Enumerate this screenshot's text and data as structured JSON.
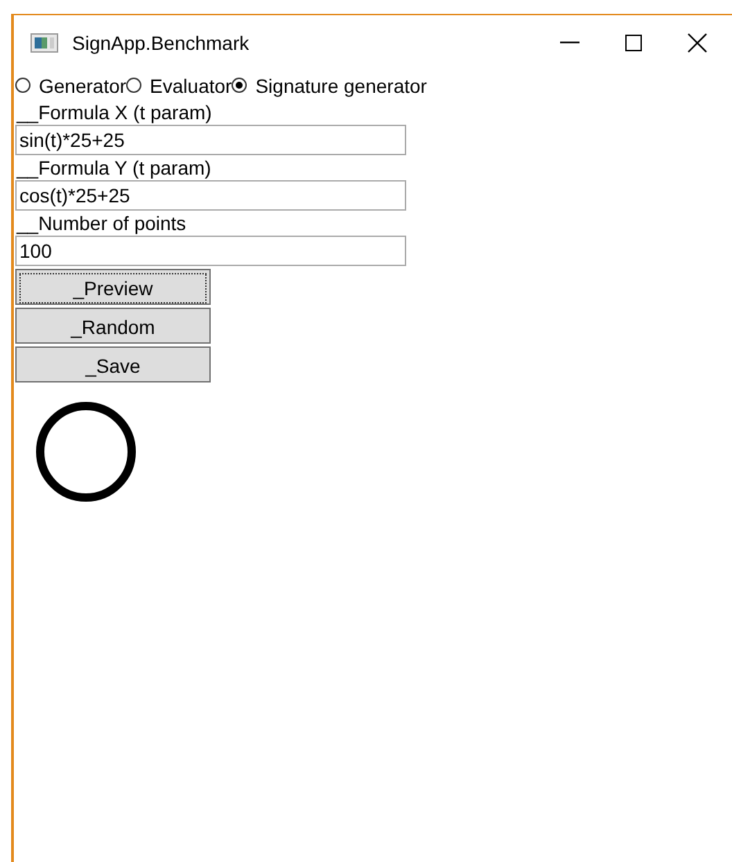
{
  "window": {
    "title": "SignApp.Benchmark"
  },
  "modes": [
    {
      "label": "Generator",
      "selected": false
    },
    {
      "label": "Evaluator",
      "selected": false
    },
    {
      "label": "Signature generator",
      "selected": true
    }
  ],
  "fields": [
    {
      "label": "__Formula X (t param)",
      "value": "sin(t)*25+25"
    },
    {
      "label": "__Formula Y (t param)",
      "value": "cos(t)*25+25"
    },
    {
      "label": "__Number of points",
      "value": "100"
    }
  ],
  "buttons": [
    {
      "label": "_Preview",
      "focused": true
    },
    {
      "label": "_Random",
      "focused": false
    },
    {
      "label": "_Save",
      "focused": false
    }
  ]
}
